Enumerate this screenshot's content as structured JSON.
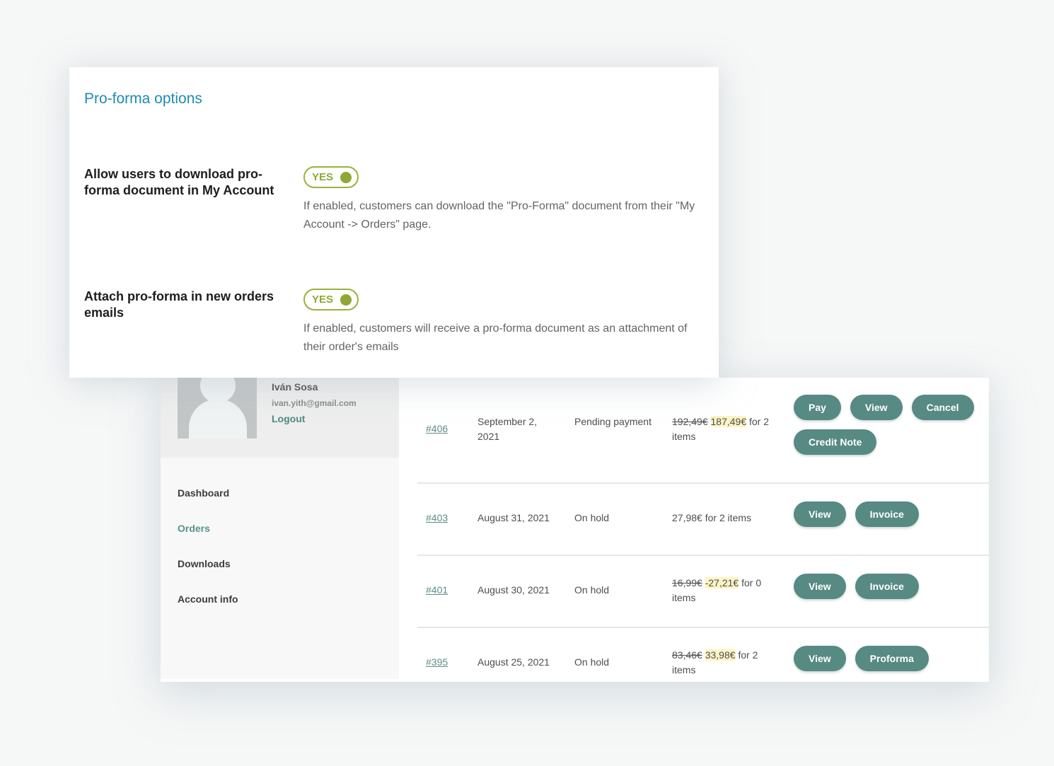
{
  "options": {
    "title": "Pro-forma options",
    "items": [
      {
        "label": "Allow users to download pro-forma document in My Account",
        "toggle": "YES",
        "enabled": true,
        "description": "If enabled, customers can download the \"Pro-Forma\" document from their \"My Account -> Orders\" page."
      },
      {
        "label": "Attach pro-forma in new orders emails",
        "toggle": "YES",
        "enabled": true,
        "description": "If enabled, customers will receive a pro-forma document as an attachment of their order's emails"
      }
    ]
  },
  "account": {
    "profile": {
      "name": "Iván Sosa",
      "email": "ivan.yith@gmail.com",
      "logout": "Logout"
    },
    "nav": [
      {
        "label": "Dashboard",
        "active": false
      },
      {
        "label": "Orders",
        "active": true
      },
      {
        "label": "Downloads",
        "active": false
      },
      {
        "label": "Account info",
        "active": false
      }
    ],
    "orders": [
      {
        "number": "#406",
        "date": "September 2, 2021",
        "status": "Pending payment",
        "old_total": "192,49€",
        "total": "187,49€",
        "items": "for 2 items",
        "actions": [
          "Pay",
          "View",
          "Cancel",
          "Credit Note"
        ]
      },
      {
        "number": "#403",
        "date": "August 31, 2021",
        "status": "On hold",
        "old_total": "",
        "total": "27,98€",
        "items": "for 2 items",
        "actions": [
          "View",
          "Invoice"
        ]
      },
      {
        "number": "#401",
        "date": "August 30, 2021",
        "status": "On hold",
        "old_total": "16,99€",
        "total": "-27,21€",
        "items": "for 0 items",
        "actions": [
          "View",
          "Invoice"
        ]
      },
      {
        "number": "#395",
        "date": "August 25, 2021",
        "status": "On hold",
        "old_total": "83,46€",
        "total": "33,98€",
        "items": "for 2 items",
        "actions": [
          "View",
          "Proforma"
        ]
      }
    ]
  },
  "colors": {
    "title_blue": "#1f8bb0",
    "toggle_green": "#8fa734",
    "button_teal": "#568a83",
    "link_teal": "#5d8e88",
    "highlight": "#fdf4c4"
  }
}
